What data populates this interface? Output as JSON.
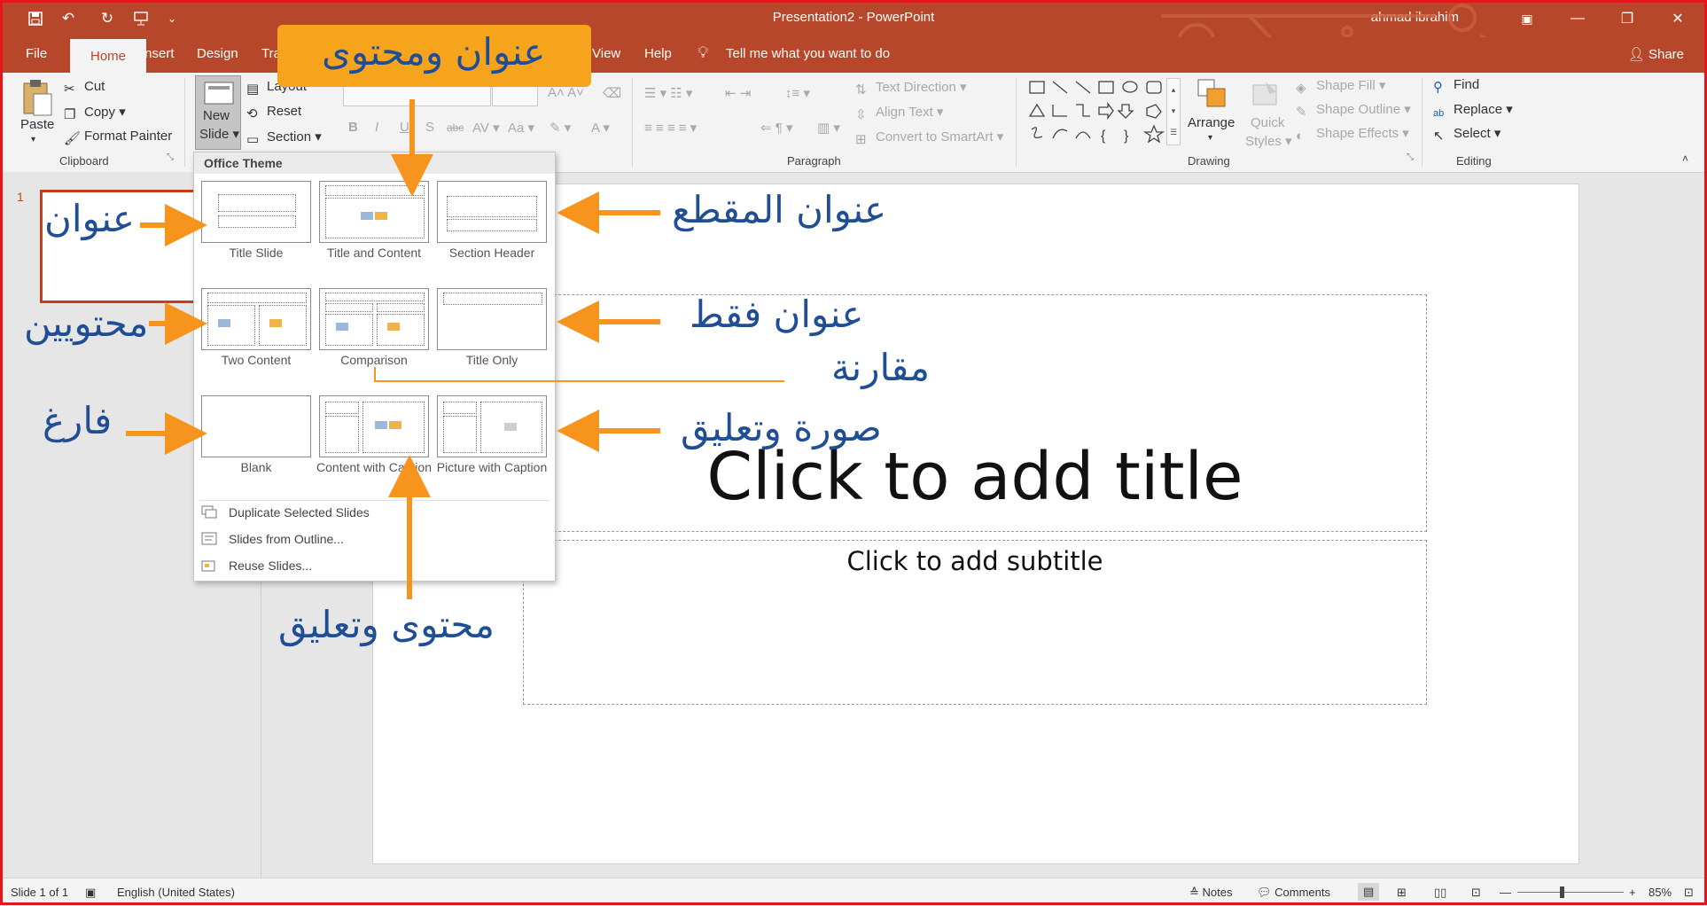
{
  "window": {
    "title": "Presentation2 - PowerPoint",
    "user": "ahmad ibrahim",
    "controls": [
      "▣",
      "—",
      "❐",
      "✕"
    ]
  },
  "quick_access": [
    "save-icon",
    "undo-icon",
    "redo-icon",
    "present-icon",
    "customize-icon"
  ],
  "tabs": {
    "file": "File",
    "home": "Home",
    "insert": "Insert",
    "design": "Design",
    "transitions": "Tra",
    "view": "View",
    "help": "Help",
    "tell_me": "Tell me what you want to do",
    "share": "Share"
  },
  "ribbon": {
    "clipboard": {
      "paste": "Paste",
      "cut": "Cut",
      "copy": "Copy",
      "format_painter": "Format Painter",
      "label": "Clipboard"
    },
    "slides": {
      "new_slide_1": "New",
      "new_slide_2": "Slide",
      "layout": "Layout",
      "reset": "Reset",
      "section": "Section"
    },
    "paragraph": {
      "text_direction": "Text Direction",
      "align_text": "Align Text",
      "convert_smartart": "Convert to SmartArt",
      "label": "Paragraph"
    },
    "drawing": {
      "arrange": "Arrange",
      "quick_styles_1": "Quick",
      "quick_styles_2": "Styles",
      "shape_fill": "Shape Fill",
      "shape_outline": "Shape Outline",
      "shape_effects": "Shape Effects",
      "label": "Drawing"
    },
    "editing": {
      "find": "Find",
      "replace": "Replace",
      "select": "Select",
      "label": "Editing"
    }
  },
  "dropdown": {
    "header": "Office Theme",
    "layouts": [
      {
        "name": "Title Slide"
      },
      {
        "name": "Title and Content"
      },
      {
        "name": "Section Header"
      },
      {
        "name": "Two Content"
      },
      {
        "name": "Comparison"
      },
      {
        "name": "Title Only"
      },
      {
        "name": "Blank"
      },
      {
        "name": "Content with Caption"
      },
      {
        "name": "Picture with Caption"
      }
    ],
    "items": [
      "Duplicate Selected Slides",
      "Slides from Outline...",
      "Reuse Slides..."
    ]
  },
  "slide": {
    "number": "1",
    "title_placeholder": "Click to add title",
    "subtitle_placeholder": "Click to add subtitle"
  },
  "annotations": {
    "title_and_content": "عنوان ومحتوى",
    "title": "عنوان",
    "two_content": "محتويين",
    "blank": "فارغ",
    "section_header": "عنوان المقطع",
    "title_only": "عنوان فقط",
    "comparison": "مقارنة",
    "picture_caption": "صورة وتعليق",
    "content_caption": "محتوى وتعليق"
  },
  "status": {
    "slide_count": "Slide 1 of 1",
    "language": "English (United States)",
    "notes": "Notes",
    "comments": "Comments",
    "zoom": "85%"
  },
  "colors": {
    "accent": "#b7472a",
    "annotation": "#f7a41d",
    "annotation_text": "#1f4e96"
  }
}
